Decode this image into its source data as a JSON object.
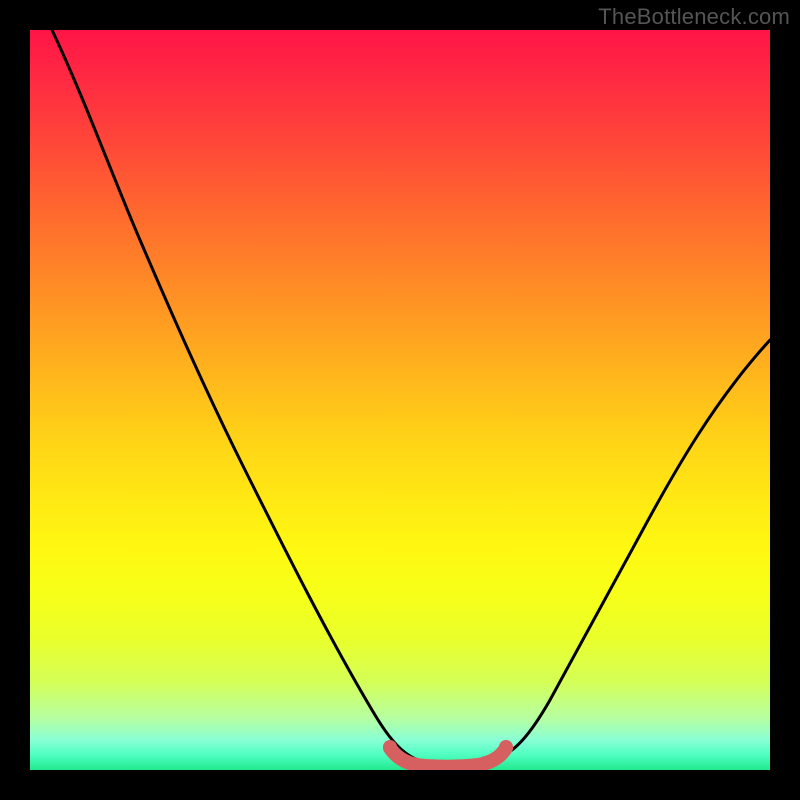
{
  "watermark": "TheBottleneck.com",
  "colors": {
    "frame": "#000000",
    "curve": "#000000",
    "vertex_marker": "#d66060"
  },
  "chart_data": {
    "type": "line",
    "title": "",
    "xlabel": "",
    "ylabel": "",
    "xlim": [
      0,
      100
    ],
    "ylim": [
      0,
      100
    ],
    "series": [
      {
        "name": "bottleneck-curve",
        "x": [
          3,
          8,
          14,
          20,
          26,
          32,
          38,
          44,
          48,
          52,
          56,
          60,
          64,
          70,
          76,
          82,
          88,
          94,
          100
        ],
        "y": [
          100,
          90,
          78,
          66,
          54,
          42,
          30,
          18,
          9,
          3,
          1,
          1,
          3,
          9,
          18,
          28,
          38,
          48,
          58
        ]
      }
    ],
    "annotations": [
      {
        "name": "vertex-marker",
        "shape": "rounded-segment",
        "x_range": [
          49,
          63
        ],
        "y": 1,
        "color": "#d66060"
      }
    ],
    "grid": false,
    "legend": false
  }
}
